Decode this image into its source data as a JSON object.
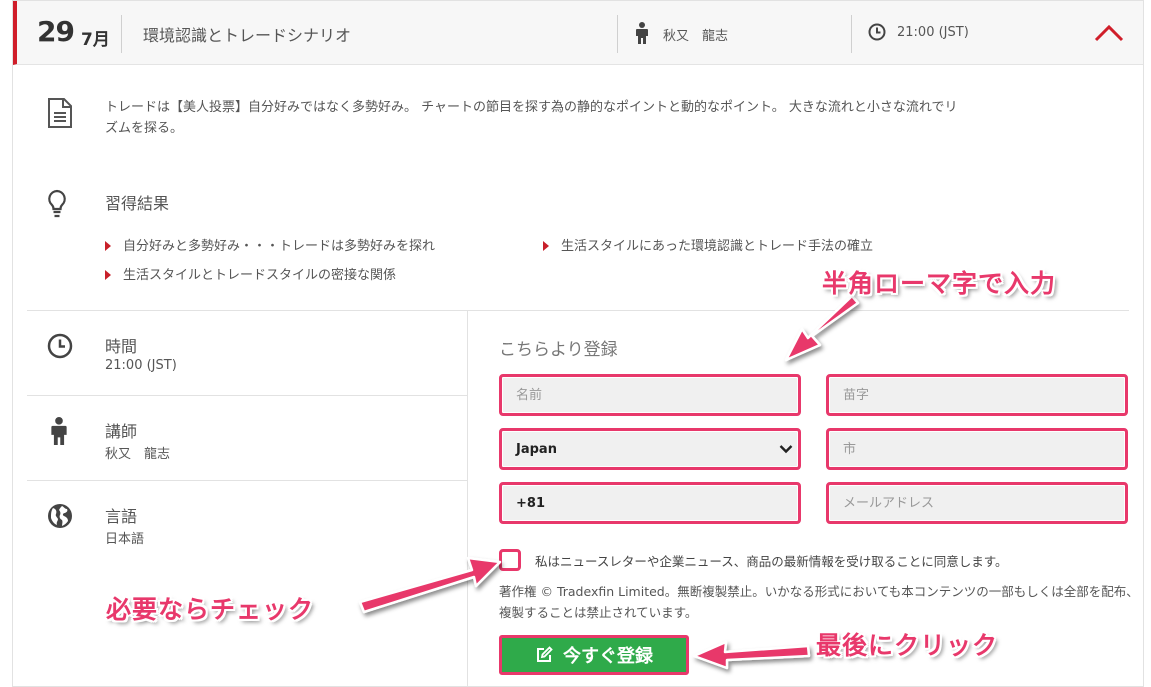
{
  "header": {
    "day": "29",
    "month": "7月",
    "title": "環境認識とトレードシナリオ",
    "instructor": "秋又　龍志",
    "time": "21:00 (JST)"
  },
  "description": "トレードは【美人投票】自分好みではなく多勢好み。 チャートの節目を探す為の静的なポイントと動的なポイント。 大きな流れと小さな流れでリズムを探る。",
  "results": {
    "title": "習得結果",
    "items": [
      "自分好みと多勢好み・・・トレードは多勢好みを探れ",
      "生活スタイルにあった環境認識とトレード手法の確立",
      "生活スタイルとトレードスタイルの密接な関係"
    ]
  },
  "info": {
    "time_label": "時間",
    "time_value": "21:00 (JST)",
    "instructor_label": "講師",
    "instructor_value": "秋又　龍志",
    "language_label": "言語",
    "language_value": "日本語"
  },
  "form": {
    "title": "こちらより登録",
    "first_name_placeholder": "名前",
    "last_name_placeholder": "苗字",
    "country_value": "Japan",
    "city_placeholder": "市",
    "phone_value": "+81",
    "email_placeholder": "メールアドレス",
    "consent_text": "私はニュースレターや企業ニュース、商品の最新情報を受け取ることに同意します。",
    "copyright": "著作権 © Tradexfin Limited。無断複製禁止。いかなる形式においても本コンテンツの一部もしくは全部を配布、複製することは禁止されています。",
    "register_label": "今すぐ登録"
  },
  "annotations": {
    "romaji": "半角ローマ字で入力",
    "check": "必要ならチェック",
    "click": "最後にクリック"
  },
  "colors": {
    "accent_red": "#d01e2a",
    "highlight_pink": "#e8386b",
    "button_green": "#2faa4a"
  }
}
